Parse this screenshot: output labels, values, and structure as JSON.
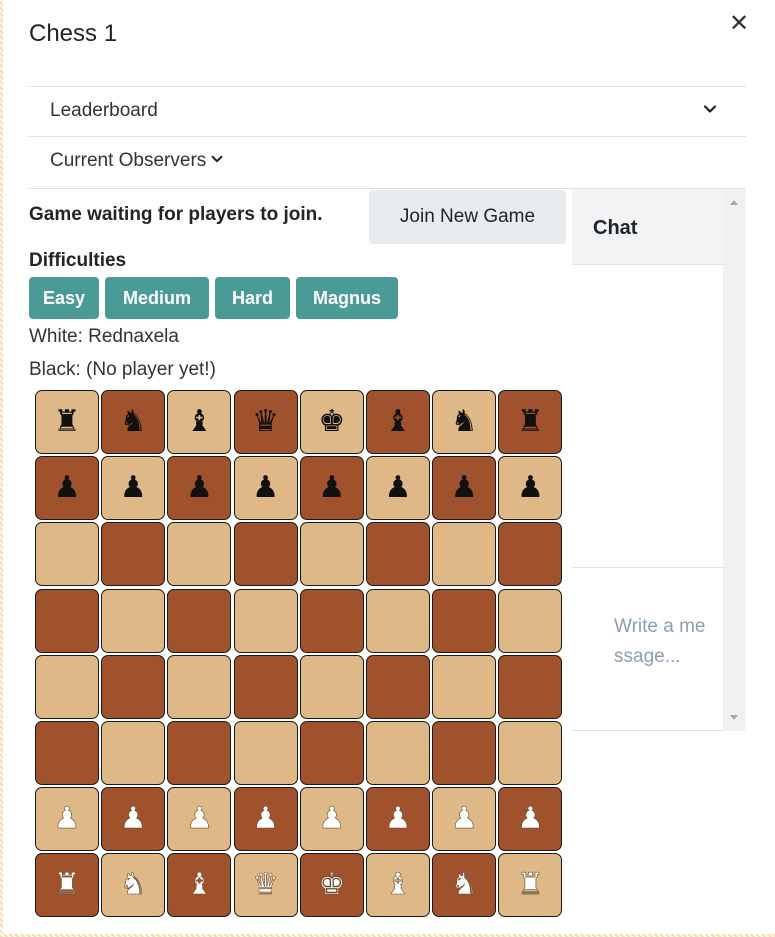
{
  "window": {
    "title": "Chess 1",
    "close_symbol": "✕"
  },
  "accordion": {
    "leaderboard_label": "Leaderboard",
    "observers_label": "Current Observers"
  },
  "game": {
    "status": "Game waiting for players to join.",
    "join_label": "Join New Game",
    "difficulties_label": "Difficulties",
    "difficulties": [
      "Easy",
      "Medium",
      "Hard",
      "Magnus"
    ],
    "white_player": "White: Rednaxela",
    "black_player": "Black: (No player yet!)"
  },
  "board": {
    "square_colors": {
      "light": "#deb887",
      "dark": "#a0522d"
    },
    "accent_color": "#4a9b95",
    "top_left_dark": false,
    "rows": [
      [
        [
          "rook",
          "black"
        ],
        [
          "knight",
          "black"
        ],
        [
          "bishop",
          "black"
        ],
        [
          "queen",
          "black"
        ],
        [
          "king",
          "black"
        ],
        [
          "bishop",
          "black"
        ],
        [
          "knight",
          "black"
        ],
        [
          "rook",
          "black"
        ]
      ],
      [
        [
          "pawn",
          "black"
        ],
        [
          "pawn",
          "black"
        ],
        [
          "pawn",
          "black"
        ],
        [
          "pawn",
          "black"
        ],
        [
          "pawn",
          "black"
        ],
        [
          "pawn",
          "black"
        ],
        [
          "pawn",
          "black"
        ],
        [
          "pawn",
          "black"
        ]
      ],
      [
        null,
        null,
        null,
        null,
        null,
        null,
        null,
        null
      ],
      [
        null,
        null,
        null,
        null,
        null,
        null,
        null,
        null
      ],
      [
        null,
        null,
        null,
        null,
        null,
        null,
        null,
        null
      ],
      [
        null,
        null,
        null,
        null,
        null,
        null,
        null,
        null
      ],
      [
        [
          "pawn",
          "white"
        ],
        [
          "pawn",
          "white"
        ],
        [
          "pawn",
          "white"
        ],
        [
          "pawn",
          "white"
        ],
        [
          "pawn",
          "white"
        ],
        [
          "pawn",
          "white"
        ],
        [
          "pawn",
          "white"
        ],
        [
          "pawn",
          "white"
        ]
      ],
      [
        [
          "rook",
          "white"
        ],
        [
          "knight",
          "white"
        ],
        [
          "bishop",
          "white"
        ],
        [
          "queen",
          "white"
        ],
        [
          "king",
          "white"
        ],
        [
          "bishop",
          "white"
        ],
        [
          "knight",
          "white"
        ],
        [
          "rook",
          "white"
        ]
      ]
    ]
  },
  "chat": {
    "title": "Chat",
    "placeholder": "Write a message..."
  }
}
